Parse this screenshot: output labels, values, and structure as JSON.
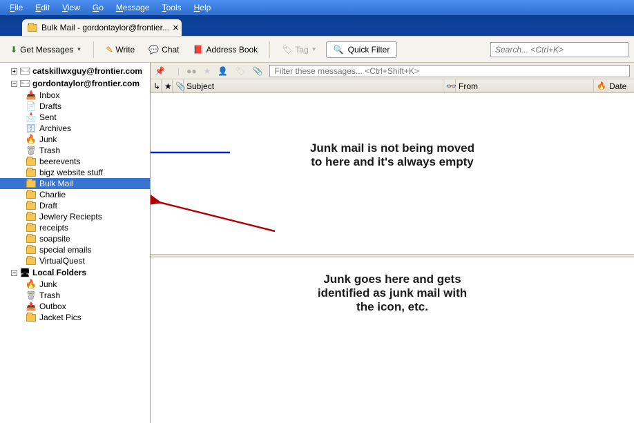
{
  "menu": {
    "file": "File",
    "edit": "Edit",
    "view": "View",
    "go": "Go",
    "message": "Message",
    "tools": "Tools",
    "help": "Help"
  },
  "tab": {
    "title": "Bulk Mail - gordontaylor@frontier..."
  },
  "toolbar": {
    "getmessages": "Get Messages",
    "write": "Write",
    "chat": "Chat",
    "addressbook": "Address Book",
    "tag": "Tag",
    "quickfilter": "Quick Filter",
    "search_placeholder": "Search... <Ctrl+K>"
  },
  "accounts": [
    {
      "name": "catskillwxguy@frontier.com",
      "expanded": false
    },
    {
      "name": "gordontaylor@frontier.com",
      "expanded": true,
      "folders": [
        {
          "label": "Inbox",
          "type": "inbox"
        },
        {
          "label": "Drafts",
          "type": "drafts"
        },
        {
          "label": "Sent",
          "type": "sent"
        },
        {
          "label": "Archives",
          "type": "archive"
        },
        {
          "label": "Junk",
          "type": "junk"
        },
        {
          "label": "Trash",
          "type": "trash"
        },
        {
          "label": "beerevents",
          "type": "folder"
        },
        {
          "label": "bigz website stuff",
          "type": "folder"
        },
        {
          "label": "Bulk Mail",
          "type": "folder",
          "selected": true
        },
        {
          "label": "Charlie",
          "type": "folder"
        },
        {
          "label": "Draft",
          "type": "folder"
        },
        {
          "label": "Jewlery Reciepts",
          "type": "folder"
        },
        {
          "label": "receipts",
          "type": "folder"
        },
        {
          "label": "soapsite",
          "type": "folder"
        },
        {
          "label": "special emails",
          "type": "folder"
        },
        {
          "label": "VirtualQuest",
          "type": "folder"
        }
      ]
    }
  ],
  "local": {
    "title": "Local Folders",
    "folders": [
      {
        "label": "Junk",
        "type": "junk"
      },
      {
        "label": "Trash",
        "type": "trash"
      },
      {
        "label": "Outbox",
        "type": "outbox"
      },
      {
        "label": "Jacket Pics",
        "type": "folder"
      }
    ]
  },
  "filter": {
    "placeholder": "Filter these messages... <Ctrl+Shift+K>"
  },
  "columns": {
    "subject": "Subject",
    "from": "From",
    "date": "Date"
  },
  "annotations": {
    "top": "Junk mail is not being moved\nto here and it's always empty",
    "bottom": "Junk goes here and gets\nidentified as junk mail with\nthe icon, etc."
  }
}
